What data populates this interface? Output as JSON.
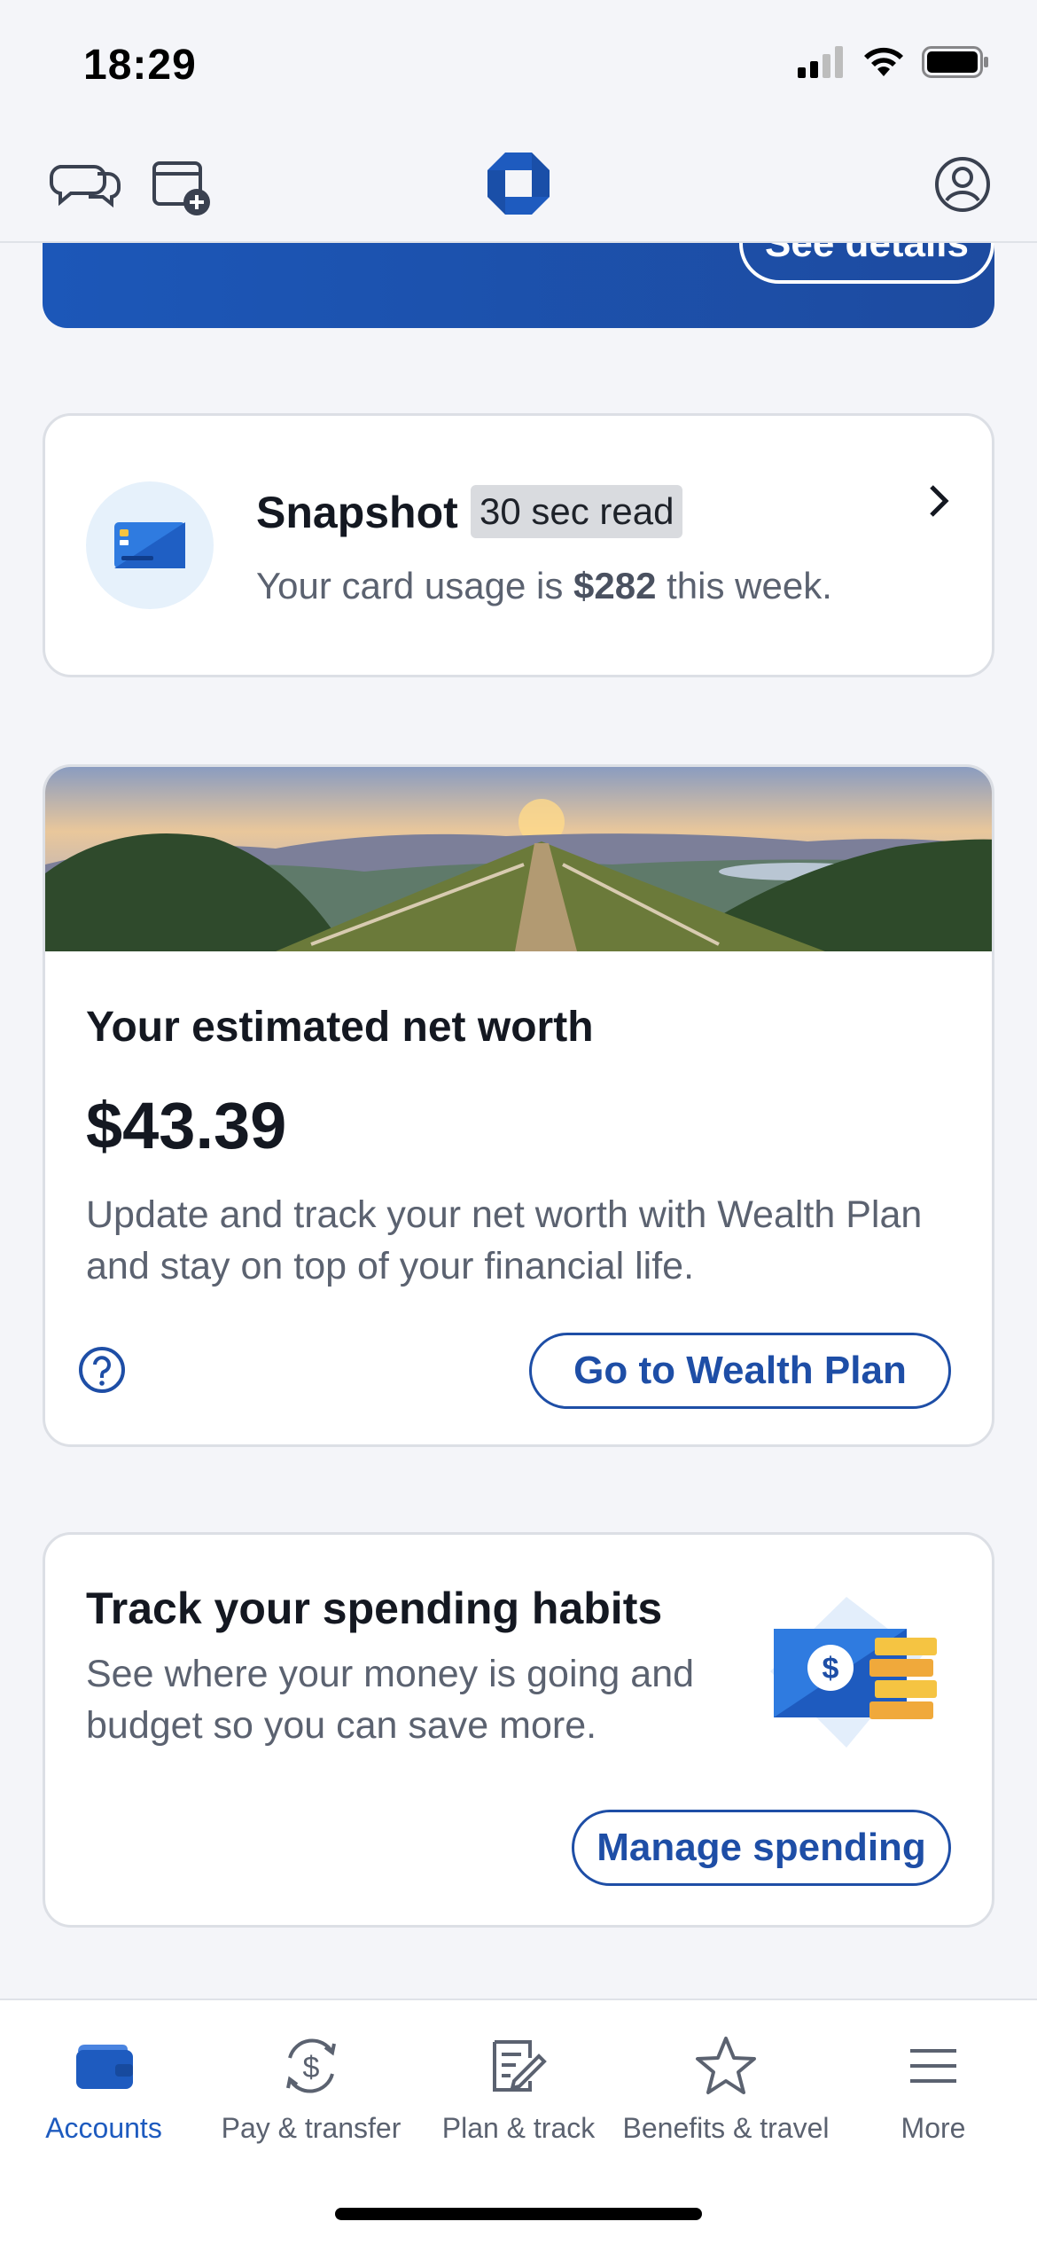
{
  "status_bar": {
    "time": "18:29"
  },
  "header": {
    "icons": [
      "chat-icon",
      "add-card-icon",
      "chase-logo",
      "profile-icon"
    ]
  },
  "banner": {
    "button_label": "See details"
  },
  "snapshot": {
    "title": "Snapshot",
    "badge": "30 sec read",
    "text_prefix": "Your card usage is ",
    "amount": "$282",
    "text_suffix": " this week."
  },
  "net_worth": {
    "title": "Your estimated net worth",
    "value": "$43.39",
    "description": "Update and track your net worth with Wealth Plan and stay on top of your financial life.",
    "button_label": "Go to Wealth Plan"
  },
  "spending": {
    "title": "Track your spending habits",
    "description": "See where your money is going and budget so you can save more.",
    "button_label": "Manage spending"
  },
  "tabs": [
    {
      "label": "Accounts",
      "icon": "wallet-icon",
      "active": true
    },
    {
      "label": "Pay & transfer",
      "icon": "pay-transfer-icon",
      "active": false
    },
    {
      "label": "Plan & track",
      "icon": "plan-track-icon",
      "active": false
    },
    {
      "label": "Benefits & travel",
      "icon": "star-icon",
      "active": false
    },
    {
      "label": "More",
      "icon": "menu-icon",
      "active": false
    }
  ],
  "colors": {
    "accent": "#1e4ea6",
    "active_tab": "#1e5bbf",
    "banner": "#1d4ba0",
    "background": "#f4f5f9"
  }
}
